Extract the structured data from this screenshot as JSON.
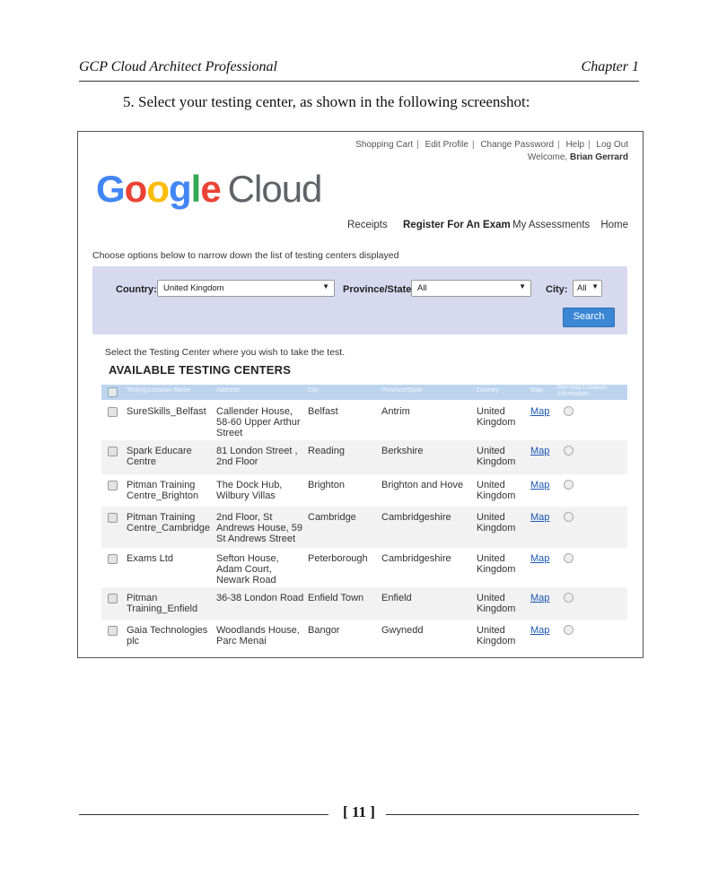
{
  "page_header": {
    "left": "GCP Cloud Architect Professional",
    "right": "Chapter 1"
  },
  "step_text": "5. Select your testing center, as shown in the following screenshot:",
  "toplinks": {
    "items": [
      "Shopping Cart",
      "Edit Profile",
      "Change Password",
      "Help",
      "Log Out"
    ],
    "welcome_prefix": "Welcome,",
    "welcome_name": "Brian Gerrard"
  },
  "logo": {
    "letters": [
      "G",
      "o",
      "o",
      "g",
      "l",
      "e"
    ],
    "word2": "Cloud"
  },
  "nav": [
    "Receipts",
    "Register For An Exam",
    "My Assessments",
    "Home"
  ],
  "narrow_text": "Choose options below to narrow down the list of testing centers displayed",
  "filter": {
    "country_label": "Country:",
    "country_value": "United Kingdom",
    "province_label": "Province/State:",
    "province_value": "All",
    "city_label": "City:",
    "city_value": "All",
    "search_label": "Search"
  },
  "select_text": "Select the Testing Center where you wish to take the test.",
  "available_title": "AVAILABLE TESTING CENTERS",
  "columns": [
    "Testing Location Name",
    "Address",
    "City",
    "Province/State",
    "Country",
    "Map",
    "Pre-Visit Location Information"
  ],
  "rows": [
    {
      "name": "SureSkills_Belfast",
      "address": "Callender House, 58-60 Upper Arthur Street",
      "city": "Belfast",
      "province": "Antrim",
      "country": "United Kingdom",
      "map": "Map"
    },
    {
      "name": "Spark Educare Centre",
      "address": "81 London Street , 2nd Floor",
      "city": "Reading",
      "province": "Berkshire",
      "country": "United Kingdom",
      "map": "Map"
    },
    {
      "name": "Pitman Training Centre_Brighton",
      "address": "The Dock Hub, Wilbury Villas",
      "city": "Brighton",
      "province": "Brighton and Hove",
      "country": "United Kingdom",
      "map": "Map"
    },
    {
      "name": "Pitman Training Centre_Cambridge",
      "address": "2nd Floor, St Andrews House, 59 St Andrews Street",
      "city": "Cambridge",
      "province": "Cambridgeshire",
      "country": "United Kingdom",
      "map": "Map"
    },
    {
      "name": "Exams Ltd",
      "address": "Sefton House, Adam Court, Newark Road",
      "city": "Peterborough",
      "province": "Cambridgeshire",
      "country": "United Kingdom",
      "map": "Map"
    },
    {
      "name": "Pitman Training_Enfield",
      "address": "36-38 London Road",
      "city": "Enfield Town",
      "province": "Enfield",
      "country": "United Kingdom",
      "map": "Map"
    },
    {
      "name": "Gaia Technologies plc",
      "address": "Woodlands House, Parc Menai",
      "city": "Bangor",
      "province": "Gwynedd",
      "country": "United Kingdom",
      "map": "Map"
    }
  ],
  "page_number": "[ 11 ]"
}
